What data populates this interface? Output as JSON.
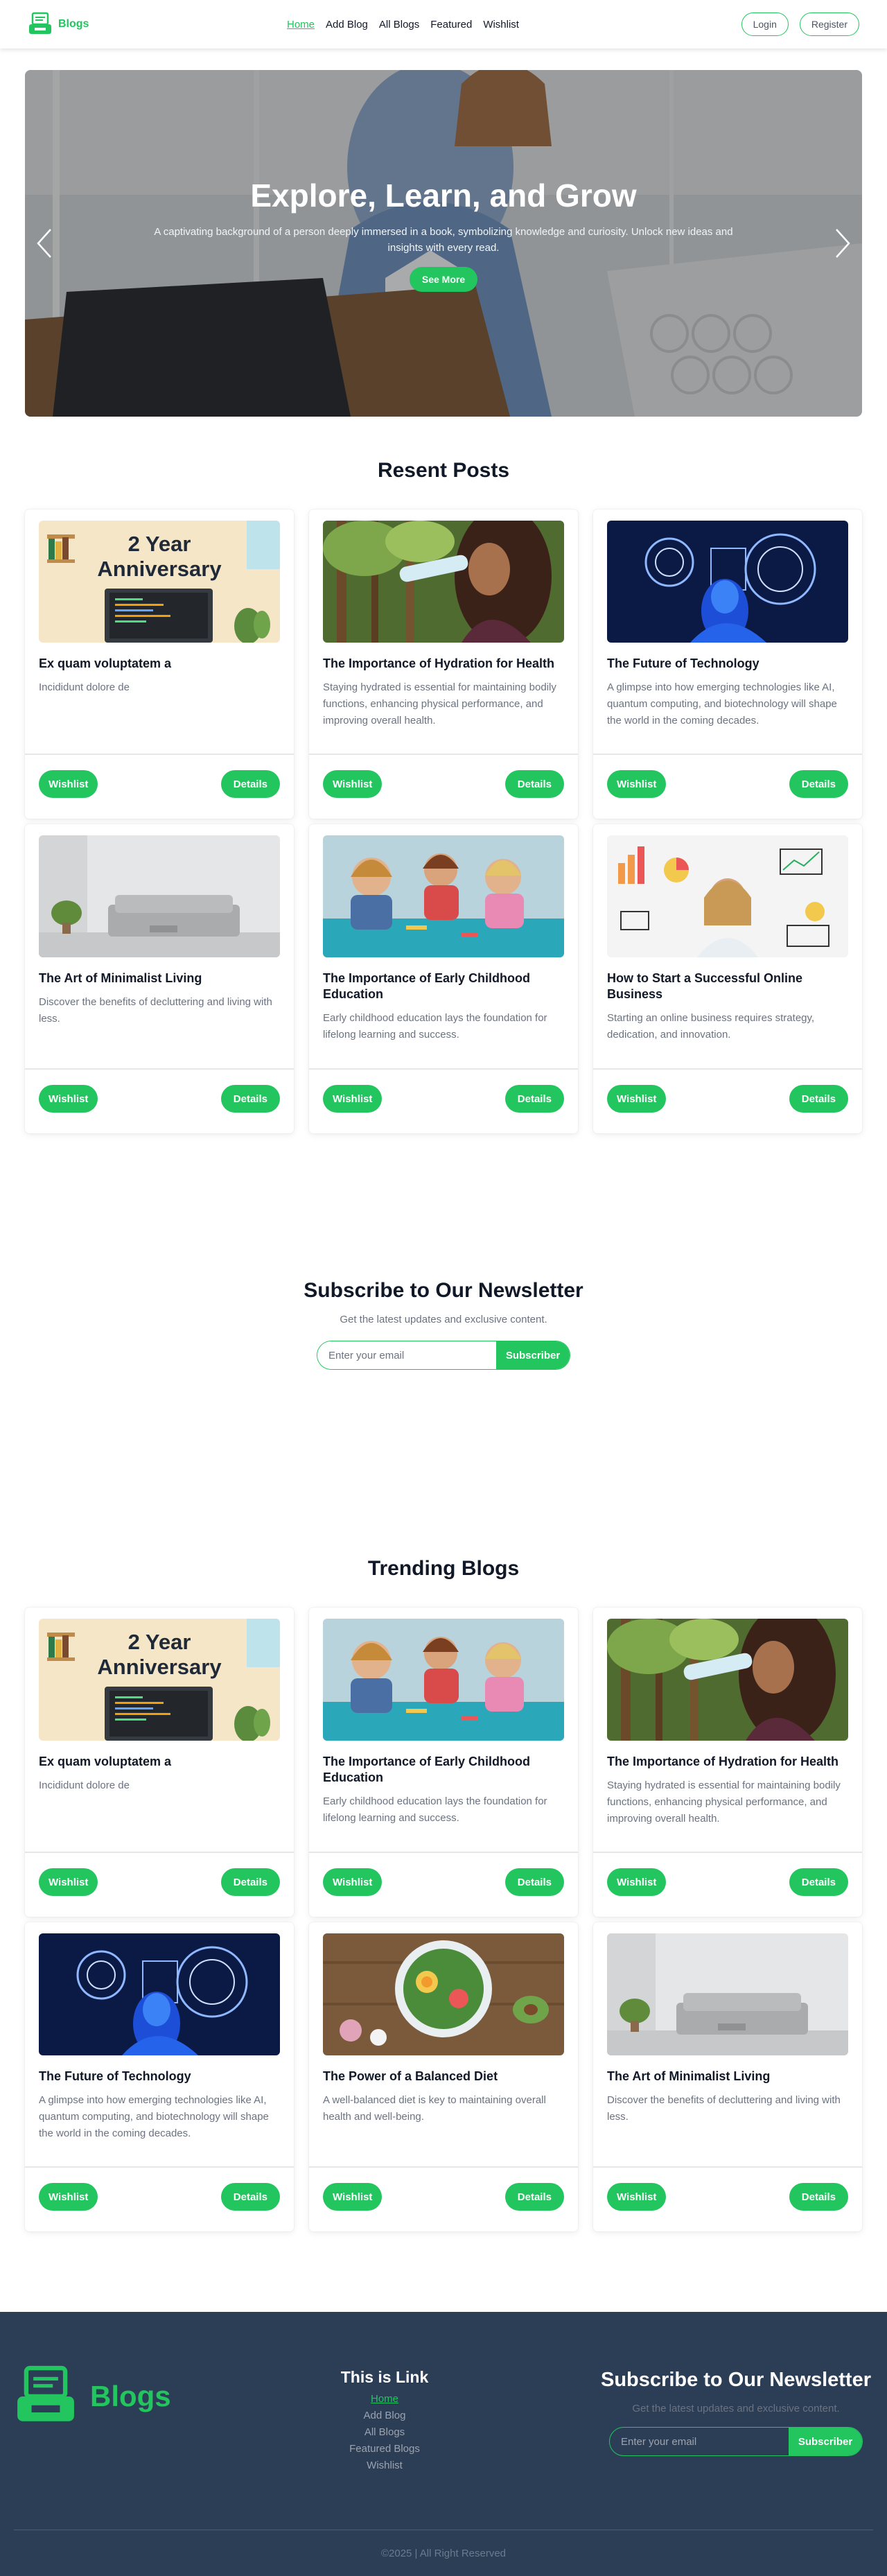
{
  "nav": {
    "brand": "Blogs",
    "links": [
      "Home",
      "Add Blog",
      "All Blogs",
      "Featured",
      "Wishlist"
    ],
    "active": "Home",
    "login": "Login",
    "register": "Register"
  },
  "hero": {
    "title": "Explore, Learn, and Grow",
    "description": "A captivating background of a person deeply immersed in a book, symbolizing knowledge and curiosity. Unlock new ideas and insights with every read.",
    "button": "See More"
  },
  "recent": {
    "heading": "Resent Posts",
    "cards": [
      {
        "title": "Ex quam voluptatem a",
        "description": "Incididunt dolore de",
        "image": "anniversary-image",
        "image_text": "2 Year Anniversary"
      },
      {
        "title": "The Importance of Hydration for Health",
        "description": "Staying hydrated is essential for maintaining bodily functions, enhancing physical performance, and improving overall health.",
        "image": "hydration-image"
      },
      {
        "title": "The Future of Technology",
        "description": "A glimpse into how emerging technologies like AI, quantum computing, and biotechnology will shape the world in the coming decades.",
        "image": "technology-image"
      },
      {
        "title": "The Art of Minimalist Living",
        "description": "Discover the benefits of decluttering and living with less.",
        "image": "minimalist-room-image"
      },
      {
        "title": "The Importance of Early Childhood Education",
        "description": "Early childhood education lays the foundation for lifelong learning and success.",
        "image": "childhood-education-image"
      },
      {
        "title": "How to Start a Successful Online Business",
        "description": "Starting an online business requires strategy, dedication, and innovation.",
        "image": "online-business-image"
      }
    ]
  },
  "trending": {
    "heading": "Trending Blogs",
    "cards": [
      {
        "title": "Ex quam voluptatem a",
        "description": "Incididunt dolore de",
        "image": "anniversary-image",
        "image_text": "2 Year Anniversary"
      },
      {
        "title": "The Importance of Early Childhood Education",
        "description": "Early childhood education lays the foundation for lifelong learning and success.",
        "image": "childhood-education-image"
      },
      {
        "title": "The Importance of Hydration for Health",
        "description": "Staying hydrated is essential for maintaining bodily functions, enhancing physical performance, and improving overall health.",
        "image": "hydration-image"
      },
      {
        "title": "The Future of Technology",
        "description": "A glimpse into how emerging technologies like AI, quantum computing, and biotechnology will shape the world in the coming decades.",
        "image": "technology-image"
      },
      {
        "title": "The Power of a Balanced Diet",
        "description": "A well-balanced diet is key to maintaining overall health and well-being.",
        "image": "balanced-diet-image"
      },
      {
        "title": "The Art of Minimalist Living",
        "description": "Discover the benefits of decluttering and living with less.",
        "image": "minimalist-room-image"
      }
    ]
  },
  "card_buttons": {
    "wishlist": "Wishlist",
    "details": "Details"
  },
  "newsletter": {
    "title": "Subscribe to Our Newsletter",
    "subtitle": "Get the latest updates and exclusive content.",
    "placeholder": "Enter your email",
    "button": "Subscriber"
  },
  "footer": {
    "brand": "Blogs",
    "links_heading": "This is Link",
    "links": [
      "Home",
      "Add Blog",
      "All Blogs",
      "Featured Blogs",
      "Wishlist"
    ],
    "newsletter_title": "Subscribe to Our Newsletter",
    "newsletter_subtitle": "Get the latest updates and exclusive content.",
    "newsletter_placeholder": "Enter your email",
    "newsletter_button": "Subscriber",
    "copyright": "©2025 | All Right Reserved"
  },
  "colors": {
    "accent": "#22c55e",
    "footer_bg": "#2c3e56"
  }
}
